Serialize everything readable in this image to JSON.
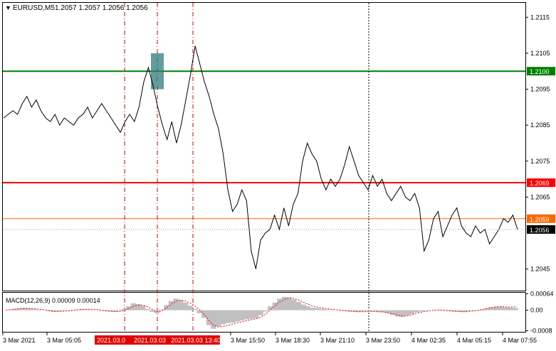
{
  "header": {
    "symbol": "EURUSD,M5",
    "ohlc": "1.2057 1.2057 1.2056 1.2056"
  },
  "indicator": {
    "label": "MACD(12,26,9) 0.00009 0.00014"
  },
  "colors": {
    "price_line": "#000000",
    "level_green": "#008000",
    "level_red": "#ff0000",
    "level_orange": "#ff6600",
    "current_price": "#000000",
    "highlight_box": "#2e7d7a",
    "vline_red": "#d00000",
    "vline_black": "#000000",
    "macd_hist": "#c0c0c0",
    "macd_signal": "#ff0000",
    "time_highlight": "#e00000"
  },
  "chart_data": [
    {
      "type": "line",
      "title": "EURUSD,M5",
      "ylim": [
        1.2039,
        1.2119
      ],
      "y_ticks": [
        "1.2115",
        "1.2105",
        "1.2095",
        "1.2085",
        "1.2075",
        "1.2065",
        "1.2045"
      ],
      "x_ticks": [
        "3 Mar 2021",
        "3 Mar 05:05",
        "3 Mar 15:50",
        "3 Mar 18:30",
        "3 Mar 21:10",
        "3 Mar 23:50",
        "4 Mar 02:35",
        "4 Mar 05:15",
        "4 Mar 07:55"
      ],
      "highlighted_times": [
        "2021.03.0",
        "2021.03.03",
        "2021.03.03 13:40"
      ],
      "levels": [
        {
          "value": 1.21,
          "label": "1.2100",
          "color": "green"
        },
        {
          "value": 1.2069,
          "label": "1.2069",
          "color": "red"
        },
        {
          "value": 1.2059,
          "label": "1.2059",
          "color": "orange"
        }
      ],
      "current_price": {
        "value": 1.2056,
        "label": "1.2056"
      },
      "series": [
        {
          "values": [
            1.2087,
            1.2088,
            1.2089,
            1.2088,
            1.2091,
            1.2093,
            1.209,
            1.2092,
            1.2089,
            1.2087,
            1.2086,
            1.2088,
            1.2085,
            1.2087,
            1.2086,
            1.2085,
            1.2087,
            1.2088,
            1.209,
            1.2087,
            1.2089,
            1.2091,
            1.2089,
            1.2087,
            1.2085,
            1.2083,
            1.2086,
            1.2088,
            1.2086,
            1.209,
            1.2097,
            1.2101,
            1.2096,
            1.209,
            1.2085,
            1.2081,
            1.2086,
            1.208,
            1.2085,
            1.2092,
            1.2099,
            1.2107,
            1.2102,
            1.2097,
            1.2093,
            1.2088,
            1.2084,
            1.2077,
            1.2067,
            1.2061,
            1.2063,
            1.2067,
            1.2064,
            1.205,
            1.2045,
            1.2053,
            1.2055,
            1.2056,
            1.206,
            1.2056,
            1.2062,
            1.2057,
            1.2063,
            1.2066,
            1.2075,
            1.208,
            1.2077,
            1.2075,
            1.207,
            1.2067,
            1.207,
            1.2068,
            1.207,
            1.2074,
            1.2079,
            1.2075,
            1.2071,
            1.2069,
            1.2067,
            1.2071,
            1.2068,
            1.207,
            1.2066,
            1.2064,
            1.2066,
            1.2068,
            1.2065,
            1.2064,
            1.2066,
            1.2062,
            1.205,
            1.2053,
            1.2059,
            1.2061,
            1.2054,
            1.2057,
            1.206,
            1.2062,
            1.2057,
            1.2055,
            1.2054,
            1.2057,
            1.2055,
            1.2056,
            1.2052,
            1.2054,
            1.2056,
            1.2059,
            1.2058,
            1.206,
            1.2056
          ]
        }
      ]
    },
    {
      "type": "bar",
      "title": "MACD(12,26,9)",
      "ylim": [
        -0.00084,
        0.00068
      ],
      "y_ticks": [
        "0.00064",
        "0.00",
        "-0.0008"
      ],
      "series": [
        {
          "type": "histogram",
          "values": [
            0.0,
            3e-05,
            6e-05,
            8e-05,
            9e-05,
            7e-05,
            4e-05,
            2e-05,
            0.0,
            -4e-05,
            -6e-05,
            -5e-05,
            -3e-05,
            -1e-05,
            1e-05,
            3e-05,
            4e-05,
            4e-05,
            2e-05,
            1e-05,
            -2e-05,
            -4e-05,
            -5e-05,
            -6e-05,
            -3e-05,
            5e-05,
            0.00015,
            0.00027,
            0.00024,
            0.00018,
            5e-05,
            -7e-05,
            -0.00012,
            3e-05,
            0.0002,
            0.00036,
            0.00045,
            0.0004,
            0.0003,
            0.00018,
            5e-05,
            -0.00012,
            -0.0003,
            -0.00058,
            -0.00072,
            -0.00063,
            -0.00055,
            -0.0005,
            -0.00048,
            -0.00044,
            -0.0004,
            -0.00036,
            -0.00034,
            -0.00031,
            -0.0002,
            -5e-05,
            0.00015,
            0.0003,
            0.00045,
            0.00052,
            0.0005,
            0.00042,
            0.00032,
            0.00022,
            0.00015,
            0.0001,
            8e-05,
            6e-05,
            4e-05,
            2e-05,
            0.0,
            -2e-05,
            -4e-05,
            -5e-05,
            -6e-05,
            -6e-05,
            -5e-05,
            -4e-05,
            -5e-05,
            -6e-05,
            -8e-05,
            -0.00012,
            -0.00018,
            -0.00024,
            -0.00026,
            -0.0002,
            -0.00015,
            -8e-05,
            -5e-05,
            -2e-05,
            0.0,
            1e-05,
            2e-05,
            -2e-05,
            -4e-05,
            -5e-05,
            -6e-05,
            -7e-05,
            -4e-05,
            -2e-05,
            1e-05,
            4e-05,
            8e-05,
            0.00012,
            0.00014,
            0.00013,
            0.00011,
            0.0001,
            9e-05
          ]
        },
        {
          "type": "line",
          "name": "signal",
          "values": [
            1e-05,
            2e-05,
            4e-05,
            6e-05,
            7e-05,
            7e-05,
            6e-05,
            4e-05,
            2e-05,
            -1e-05,
            -4e-05,
            -5e-05,
            -4e-05,
            -3e-05,
            -1e-05,
            1e-05,
            3e-05,
            4e-05,
            4e-05,
            3e-05,
            1e-05,
            -2e-05,
            -4e-05,
            -5e-05,
            -5e-05,
            -1e-05,
            6e-05,
            0.00015,
            0.0002,
            0.0002,
            0.00014,
            4e-05,
            -6e-05,
            -3e-05,
            8e-05,
            0.00022,
            0.00034,
            0.00039,
            0.00036,
            0.00028,
            0.00017,
            3e-05,
            -0.00015,
            -0.00038,
            -0.00058,
            -0.00065,
            -0.00064,
            -0.00059,
            -0.00054,
            -0.00049,
            -0.00045,
            -0.00041,
            -0.00037,
            -0.00034,
            -0.00027,
            -0.00016,
            0.0,
            0.00016,
            0.00031,
            0.00042,
            0.00047,
            0.00046,
            0.0004,
            0.00032,
            0.00024,
            0.00017,
            0.00012,
            9e-05,
            6e-05,
            4e-05,
            2e-05,
            0.0,
            -2e-05,
            -4e-05,
            -5e-05,
            -6e-05,
            -6e-05,
            -5e-05,
            -5e-05,
            -6e-05,
            -7e-05,
            -0.0001,
            -0.00014,
            -0.00019,
            -0.00023,
            -0.00022,
            -0.00018,
            -0.00012,
            -8e-05,
            -4e-05,
            -2e-05,
            0.0,
            1e-05,
            0.0,
            -2e-05,
            -4e-05,
            -5e-05,
            -6e-05,
            -5e-05,
            -3e-05,
            -1e-05,
            2e-05,
            6e-05,
            0.0001,
            0.00013,
            0.00014,
            0.00013,
            0.00012,
            0.00014
          ]
        }
      ]
    }
  ]
}
